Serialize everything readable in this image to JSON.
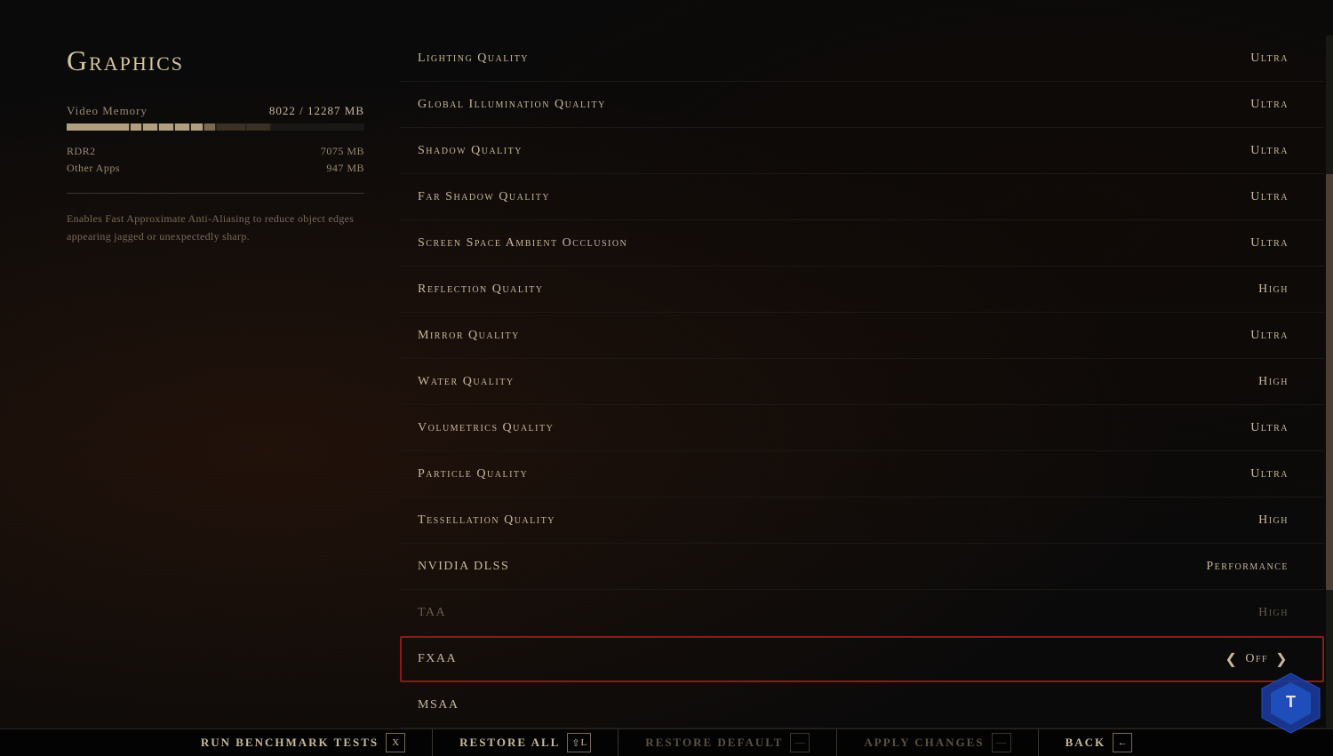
{
  "page": {
    "title": "Graphics",
    "left": {
      "memory_label": "Video Memory",
      "memory_used": "8022",
      "memory_total": "12287",
      "memory_unit": "MB",
      "memory_display": "8022 / 12287 MB",
      "apps": [
        {
          "name": "RDR2",
          "size": "7075 MB"
        },
        {
          "name": "Other Apps",
          "size": "947 MB"
        }
      ],
      "description": "Enables Fast Approximate Anti-Aliasing to reduce object edges appearing jagged or unexpectedly sharp."
    },
    "settings": [
      {
        "name": "Lighting Quality",
        "value": "Ultra",
        "selected": false,
        "dimmed": false
      },
      {
        "name": "Global Illumination Quality",
        "value": "Ultra",
        "selected": false,
        "dimmed": false
      },
      {
        "name": "Shadow Quality",
        "value": "Ultra",
        "selected": false,
        "dimmed": false
      },
      {
        "name": "Far Shadow Quality",
        "value": "Ultra",
        "selected": false,
        "dimmed": false
      },
      {
        "name": "Screen Space Ambient Occlusion",
        "value": "Ultra",
        "selected": false,
        "dimmed": false
      },
      {
        "name": "Reflection Quality",
        "value": "High",
        "selected": false,
        "dimmed": false
      },
      {
        "name": "Mirror Quality",
        "value": "Ultra",
        "selected": false,
        "dimmed": false
      },
      {
        "name": "Water Quality",
        "value": "High",
        "selected": false,
        "dimmed": false
      },
      {
        "name": "Volumetrics Quality",
        "value": "Ultra",
        "selected": false,
        "dimmed": false
      },
      {
        "name": "Particle Quality",
        "value": "Ultra",
        "selected": false,
        "dimmed": false
      },
      {
        "name": "Tessellation Quality",
        "value": "High",
        "selected": false,
        "dimmed": false
      },
      {
        "name": "NVIDIA DLSS",
        "value": "Performance",
        "selected": false,
        "dimmed": false
      },
      {
        "name": "TAA",
        "value": "High",
        "selected": false,
        "dimmed": true
      },
      {
        "name": "FXAA",
        "value": "Off",
        "selected": true,
        "dimmed": false,
        "arrows": true
      },
      {
        "name": "MSAA",
        "value": "",
        "selected": false,
        "dimmed": false
      }
    ],
    "bottom_actions": [
      {
        "label": "Run Benchmark Tests",
        "key": "X",
        "key2": null,
        "dimmed": false
      },
      {
        "label": "Restore All",
        "key": "L",
        "key2": "⇧",
        "dimmed": false
      },
      {
        "label": "Restore Default",
        "key": "—",
        "key2": null,
        "dimmed": true
      },
      {
        "label": "Apply Changes",
        "key": "—",
        "key2": null,
        "dimmed": true
      },
      {
        "label": "Back",
        "key": "←",
        "key2": null,
        "dimmed": false
      }
    ]
  }
}
